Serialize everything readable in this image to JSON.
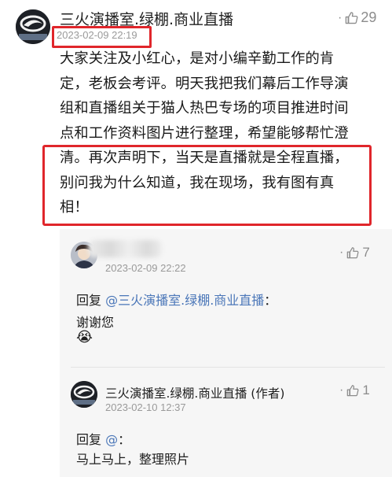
{
  "main_comment": {
    "author": "三火演播室.绿棚.商业直播",
    "timestamp": "2023-02-09 22:19",
    "likes": "29",
    "text_lines": [
      "大家关注及小红心，是对小编辛勤工作的肯",
      "定，老板会考评。明天我把我们幕后工作导演",
      "组和直播组关于猫人热巴专场的项目推进时间",
      "点和工作资料图片进行整理，希望能够帮忙澄",
      "清。再次声明下，当天是直播就是全程直播，",
      "别问我为什么知道，我在现场，我有图有真",
      "相！"
    ]
  },
  "replies": [
    {
      "author": "",
      "timestamp": "2023-02-09 22:22",
      "likes": "7",
      "reply_prefix": "回复",
      "mention": "@三火演播室.绿棚.商业直播",
      "colon": "：",
      "text": "谢谢您",
      "emoji": "😭"
    },
    {
      "author": "三火演播室.绿棚.商业直播 (作者)",
      "timestamp": "2023-02-10 12:37",
      "likes": "1",
      "reply_prefix": "回复",
      "mention": "@",
      "colon": "：",
      "text": "马上马上，整理照片"
    }
  ],
  "icons": {
    "like": "thumbs-up-icon",
    "more": "dot-icon"
  },
  "colors": {
    "highlight": "#e0262b",
    "mention": "#4a76b8",
    "meta": "#9a9a9a"
  }
}
